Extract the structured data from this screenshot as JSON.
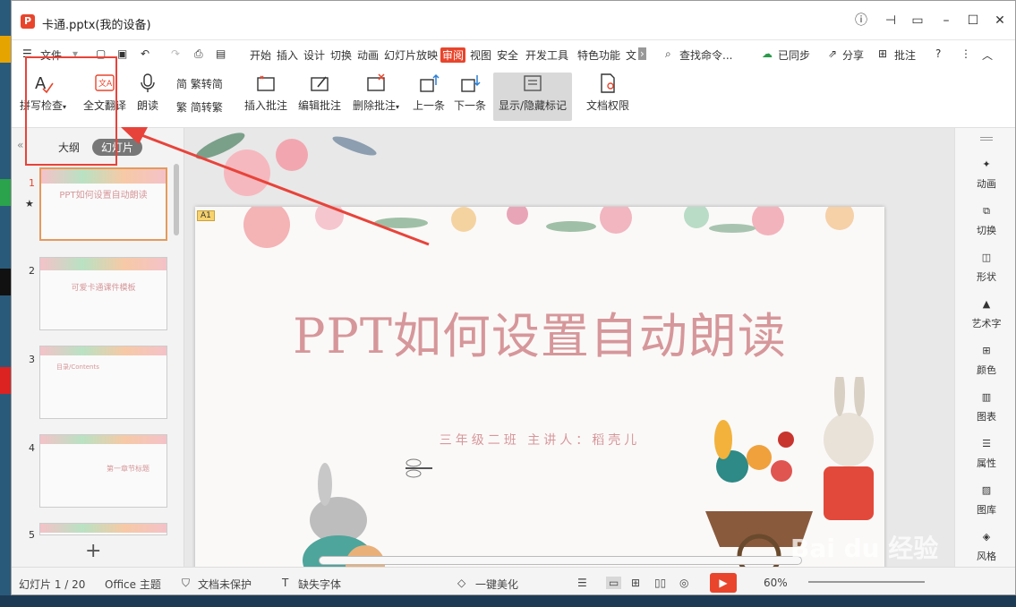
{
  "window": {
    "title": "卡通.pptx(我的设备)"
  },
  "menu": {
    "file": "文件",
    "items": [
      "开始",
      "插入",
      "设计",
      "切换",
      "动画",
      "幻灯片放映",
      "审阅",
      "视图",
      "安全",
      "开发工具",
      "特色功能",
      "文"
    ],
    "active": "审阅",
    "search": "查找命令...",
    "sync": "已同步",
    "share": "分享",
    "review": "批注"
  },
  "ribbon": {
    "spell": "拼写检查",
    "translate": "全文翻译",
    "read": "朗读",
    "trad": "繁转简",
    "simp": "简转繁",
    "insert_comment": "插入批注",
    "edit_comment": "编辑批注",
    "delete_comment": "删除批注",
    "prev": "上一条",
    "next": "下一条",
    "toggle_marks": "显示/隐藏标记",
    "doc_rights": "文档权限"
  },
  "left_panel": {
    "tab_outline": "大纲",
    "tab_slides": "幻灯片",
    "thumbs": [
      {
        "num": "1",
        "title": "PPT如何设置自动朗读"
      },
      {
        "num": "2",
        "title": "可爱卡通课件模板"
      },
      {
        "num": "3",
        "title": "目录/Contents"
      },
      {
        "num": "4",
        "title": "第一章节标题"
      },
      {
        "num": "5",
        "title": ""
      }
    ],
    "add": "+"
  },
  "slide": {
    "badge": "A1",
    "title": "PPT如何设置自动朗读",
    "subtitle": "三年级二班    主讲人：稻壳儿"
  },
  "right_panel": [
    "动画",
    "切换",
    "形状",
    "艺术字",
    "颜色",
    "图表",
    "属性",
    "图库",
    "风格"
  ],
  "status": {
    "slide_pos": "幻灯片 1 / 20",
    "theme": "Office 主题",
    "protect": "文档未保护",
    "font": "缺失字体",
    "beautify": "一键美化",
    "zoom": "60%"
  },
  "colors": {
    "accent": "#e8452c",
    "slide_text": "#d6979a",
    "annotation": "#e8433a"
  }
}
